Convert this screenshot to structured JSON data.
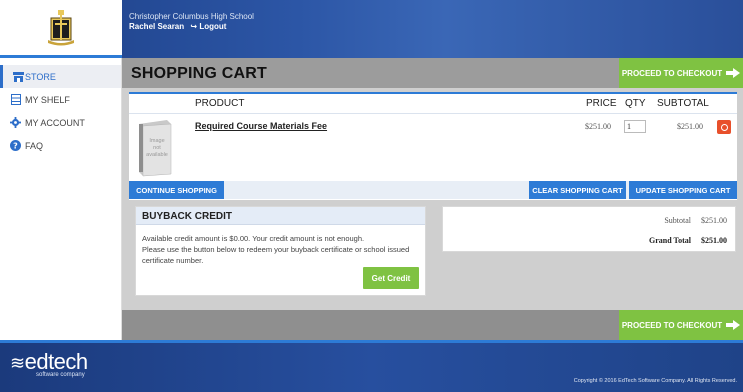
{
  "header": {
    "school_name": "Christopher Columbus High School",
    "user_name": "Rachel Searan",
    "logout_label": "Logout"
  },
  "sidebar": {
    "items": [
      {
        "label": "STORE",
        "icon": "store-icon",
        "active": true
      },
      {
        "label": "MY SHELF",
        "icon": "shelf-icon",
        "active": false
      },
      {
        "label": "MY ACCOUNT",
        "icon": "gear-icon",
        "active": false
      },
      {
        "label": "FAQ",
        "icon": "question-icon",
        "active": false
      }
    ]
  },
  "main": {
    "title": "SHOPPING CART",
    "checkout_label": "PROCEED TO CHECKOUT",
    "table": {
      "headers": {
        "product": "PRODUCT",
        "price": "PRICE",
        "qty": "QTY",
        "subtotal": "SUBTOTAL"
      },
      "rows": [
        {
          "image_text": [
            "Image",
            "not",
            "available"
          ],
          "product": "Required Course Materials Fee",
          "price": "$251.00",
          "qty": "1",
          "subtotal": "$251.00"
        }
      ]
    },
    "actions": {
      "continue": "CONTINUE SHOPPING",
      "clear": "CLEAR SHOPPING CART",
      "update": "UPDATE SHOPPING CART"
    },
    "buyback": {
      "title": "BUYBACK CREDIT",
      "line1": "Available credit amount is $0.00. Your credit amount is not enough.",
      "line2": "Please use the button below to redeem your buyback certificate or school issued certificate number.",
      "button": "Get Credit"
    },
    "totals": {
      "subtotal_label": "Subtotal",
      "subtotal_value": "$251.00",
      "grand_label": "Grand Total",
      "grand_value": "$251.00"
    }
  },
  "footer": {
    "brand": "edtech",
    "tagline": "software company",
    "copyright": "Copyright © 2016 EdTech Software Company. All Rights Reserved."
  },
  "colors": {
    "accent_blue": "#2d7bd6",
    "checkout_green": "#7fc242",
    "remove_red": "#e8502b"
  }
}
